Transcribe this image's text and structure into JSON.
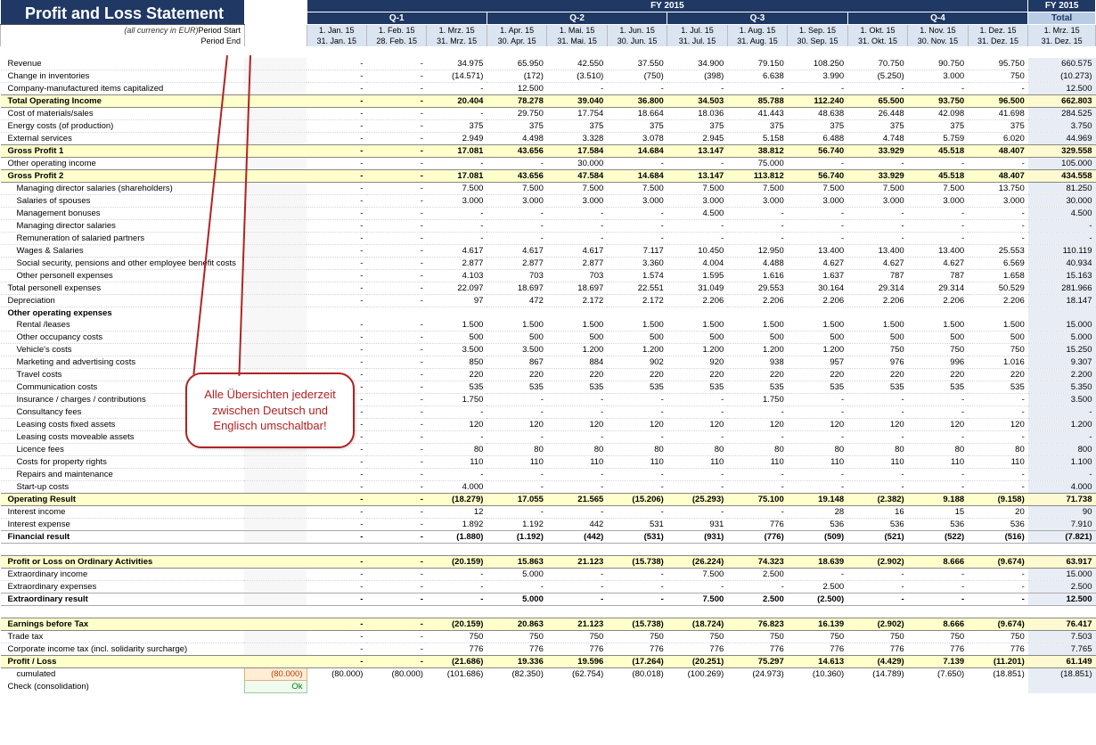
{
  "title": "Profit and Loss Statement",
  "subtitle": "(all currency in EUR)",
  "fy_label": "FY 2015",
  "total_label": "Total",
  "quarters": [
    "Q-1",
    "Q-2",
    "Q-3",
    "Q-4"
  ],
  "period_start_label": "Period Start",
  "period_end_label": "Period End",
  "period_start": [
    "1. Jan. 15",
    "1. Feb. 15",
    "1. Mrz. 15",
    "1. Apr. 15",
    "1. Mai. 15",
    "1. Jun. 15",
    "1. Jul. 15",
    "1. Aug. 15",
    "1. Sep. 15",
    "1. Okt. 15",
    "1. Nov. 15",
    "1. Dez. 15"
  ],
  "period_end": [
    "31. Jan. 15",
    "28. Feb. 15",
    "31. Mrz. 15",
    "30. Apr. 15",
    "31. Mai. 15",
    "30. Jun. 15",
    "31. Jul. 15",
    "31. Aug. 15",
    "30. Sep. 15",
    "31. Okt. 15",
    "30. Nov. 15",
    "31. Dez. 15"
  ],
  "total_period_start": "1. Mrz. 15",
  "total_period_end": "31. Dez. 15",
  "group_value": "(80.000)",
  "ok_value": "Ok",
  "callout_text": "Alle Übersichten jederzeit zwischen Deutsch und Englisch umschaltbar!",
  "rows": [
    {
      "k": "sp"
    },
    {
      "k": "l",
      "cls": "",
      "lbl": "Revenue",
      "v": [
        "-",
        "-",
        "34.975",
        "65.950",
        "42.550",
        "37.550",
        "34.900",
        "79.150",
        "108.250",
        "70.750",
        "90.750",
        "95.750"
      ],
      "t": "660.575"
    },
    {
      "k": "l",
      "cls": "",
      "lbl": "Change in inventories",
      "v": [
        "-",
        "-",
        "(14.571)",
        "(172)",
        "(3.510)",
        "(750)",
        "(398)",
        "6.638",
        "3.990",
        "(5.250)",
        "3.000",
        "750"
      ],
      "t": "(10.273)"
    },
    {
      "k": "l",
      "cls": "",
      "lbl": "Company-manufactured items capitalized",
      "v": [
        "-",
        "-",
        "-",
        "12.500",
        "-",
        "-",
        "-",
        "-",
        "-",
        "-",
        "-",
        "-"
      ],
      "t": "12.500"
    },
    {
      "k": "s",
      "lbl": "Total Operating Income",
      "v": [
        "-",
        "-",
        "20.404",
        "78.278",
        "39.040",
        "36.800",
        "34.503",
        "85.788",
        "112.240",
        "65.500",
        "93.750",
        "96.500"
      ],
      "t": "662.803"
    },
    {
      "k": "l",
      "cls": "",
      "lbl": "Cost of materials/sales",
      "v": [
        "-",
        "-",
        "-",
        "29.750",
        "17.754",
        "18.664",
        "18.036",
        "41.443",
        "48.638",
        "26.448",
        "42.098",
        "41.698"
      ],
      "t": "284.525"
    },
    {
      "k": "l",
      "cls": "",
      "lbl": "Energy costs (of production)",
      "v": [
        "-",
        "-",
        "375",
        "375",
        "375",
        "375",
        "375",
        "375",
        "375",
        "375",
        "375",
        "375"
      ],
      "t": "3.750"
    },
    {
      "k": "l",
      "cls": "",
      "lbl": "External services",
      "v": [
        "-",
        "-",
        "2.949",
        "4.498",
        "3.328",
        "3.078",
        "2.945",
        "5.158",
        "6.488",
        "4.748",
        "5.759",
        "6.020"
      ],
      "t": "44.969"
    },
    {
      "k": "s",
      "lbl": "Gross Profit 1",
      "v": [
        "-",
        "-",
        "17.081",
        "43.656",
        "17.584",
        "14.684",
        "13.147",
        "38.812",
        "56.740",
        "33.929",
        "45.518",
        "48.407"
      ],
      "t": "329.558"
    },
    {
      "k": "l",
      "cls": "",
      "lbl": "Other operating income",
      "v": [
        "-",
        "-",
        "-",
        "-",
        "30.000",
        "-",
        "-",
        "75.000",
        "-",
        "-",
        "-",
        "-"
      ],
      "t": "105.000"
    },
    {
      "k": "s",
      "lbl": "Gross Profit 2",
      "v": [
        "-",
        "-",
        "17.081",
        "43.656",
        "47.584",
        "14.684",
        "13.147",
        "113.812",
        "56.740",
        "33.929",
        "45.518",
        "48.407"
      ],
      "t": "434.558"
    },
    {
      "k": "l",
      "cls": "ind1",
      "lbl": "Managing director salaries (shareholders)",
      "v": [
        "-",
        "-",
        "7.500",
        "7.500",
        "7.500",
        "7.500",
        "7.500",
        "7.500",
        "7.500",
        "7.500",
        "7.500",
        "13.750"
      ],
      "t": "81.250"
    },
    {
      "k": "l",
      "cls": "ind1",
      "lbl": "Salaries of spouses",
      "v": [
        "-",
        "-",
        "3.000",
        "3.000",
        "3.000",
        "3.000",
        "3.000",
        "3.000",
        "3.000",
        "3.000",
        "3.000",
        "3.000"
      ],
      "t": "30.000"
    },
    {
      "k": "l",
      "cls": "ind1",
      "lbl": "Management bonuses",
      "v": [
        "-",
        "-",
        "-",
        "-",
        "-",
        "-",
        "4.500",
        "-",
        "-",
        "-",
        "-",
        "-"
      ],
      "t": "4.500"
    },
    {
      "k": "l",
      "cls": "ind1",
      "lbl": "Managing director salaries",
      "v": [
        "-",
        "-",
        "-",
        "-",
        "-",
        "-",
        "-",
        "-",
        "-",
        "-",
        "-",
        "-"
      ],
      "t": "-"
    },
    {
      "k": "l",
      "cls": "ind1",
      "lbl": "Remuneration of salaried partners",
      "v": [
        "-",
        "-",
        "-",
        "-",
        "-",
        "-",
        "-",
        "-",
        "-",
        "-",
        "-",
        "-"
      ],
      "t": "-"
    },
    {
      "k": "l",
      "cls": "ind1",
      "lbl": "Wages & Salaries",
      "v": [
        "-",
        "-",
        "4.617",
        "4.617",
        "4.617",
        "7.117",
        "10.450",
        "12.950",
        "13.400",
        "13.400",
        "13.400",
        "25.553"
      ],
      "t": "110.119"
    },
    {
      "k": "l",
      "cls": "ind1",
      "lbl": "Social security, pensions and other employee benefit costs",
      "v": [
        "-",
        "-",
        "2.877",
        "2.877",
        "2.877",
        "3.360",
        "4.004",
        "4.488",
        "4.627",
        "4.627",
        "4.627",
        "6.569"
      ],
      "t": "40.934"
    },
    {
      "k": "l",
      "cls": "ind1",
      "lbl": "Other personell expenses",
      "v": [
        "-",
        "-",
        "4.103",
        "703",
        "703",
        "1.574",
        "1.595",
        "1.616",
        "1.637",
        "787",
        "787",
        "1.658"
      ],
      "t": "15.163"
    },
    {
      "k": "l",
      "cls": "",
      "lbl": "Total personell expenses",
      "v": [
        "-",
        "-",
        "22.097",
        "18.697",
        "18.697",
        "22.551",
        "31.049",
        "29.553",
        "30.164",
        "29.314",
        "29.314",
        "50.529"
      ],
      "t": "281.966"
    },
    {
      "k": "l",
      "cls": "",
      "lbl": "Depreciation",
      "v": [
        "-",
        "-",
        "97",
        "472",
        "2.172",
        "2.172",
        "2.206",
        "2.206",
        "2.206",
        "2.206",
        "2.206",
        "2.206"
      ],
      "t": "18.147"
    },
    {
      "k": "h",
      "lbl": "Other operating expenses"
    },
    {
      "k": "l",
      "cls": "ind1",
      "lbl": "Rental /leases",
      "v": [
        "-",
        "-",
        "1.500",
        "1.500",
        "1.500",
        "1.500",
        "1.500",
        "1.500",
        "1.500",
        "1.500",
        "1.500",
        "1.500"
      ],
      "t": "15.000"
    },
    {
      "k": "l",
      "cls": "ind1",
      "lbl": "Other occupancy costs",
      "v": [
        "-",
        "-",
        "500",
        "500",
        "500",
        "500",
        "500",
        "500",
        "500",
        "500",
        "500",
        "500"
      ],
      "t": "5.000"
    },
    {
      "k": "l",
      "cls": "ind1",
      "lbl": "Vehicle's costs",
      "v": [
        "-",
        "-",
        "3.500",
        "3.500",
        "1.200",
        "1.200",
        "1.200",
        "1.200",
        "1.200",
        "750",
        "750",
        "750"
      ],
      "t": "15.250"
    },
    {
      "k": "l",
      "cls": "ind1",
      "lbl": "Marketing and advertising costs",
      "v": [
        "-",
        "-",
        "850",
        "867",
        "884",
        "902",
        "920",
        "938",
        "957",
        "976",
        "996",
        "1.016"
      ],
      "t": "9.307"
    },
    {
      "k": "l",
      "cls": "ind1",
      "lbl": "Travel costs",
      "v": [
        "-",
        "-",
        "220",
        "220",
        "220",
        "220",
        "220",
        "220",
        "220",
        "220",
        "220",
        "220"
      ],
      "t": "2.200"
    },
    {
      "k": "l",
      "cls": "ind1",
      "lbl": "Communication costs",
      "v": [
        "-",
        "-",
        "535",
        "535",
        "535",
        "535",
        "535",
        "535",
        "535",
        "535",
        "535",
        "535"
      ],
      "t": "5.350"
    },
    {
      "k": "l",
      "cls": "ind1",
      "lbl": "Insurance / charges / contributions",
      "v": [
        "-",
        "-",
        "1.750",
        "-",
        "-",
        "-",
        "-",
        "1.750",
        "-",
        "-",
        "-",
        "-"
      ],
      "t": "3.500"
    },
    {
      "k": "l",
      "cls": "ind1",
      "lbl": "Consultancy fees",
      "v": [
        "-",
        "-",
        "-",
        "-",
        "-",
        "-",
        "-",
        "-",
        "-",
        "-",
        "-",
        "-"
      ],
      "t": "-"
    },
    {
      "k": "l",
      "cls": "ind1",
      "lbl": "Leasing costs fixed assets",
      "v": [
        "-",
        "-",
        "120",
        "120",
        "120",
        "120",
        "120",
        "120",
        "120",
        "120",
        "120",
        "120"
      ],
      "t": "1.200"
    },
    {
      "k": "l",
      "cls": "ind1",
      "lbl": "Leasing costs moveable assets",
      "v": [
        "-",
        "-",
        "-",
        "-",
        "-",
        "-",
        "-",
        "-",
        "-",
        "-",
        "-",
        "-"
      ],
      "t": "-"
    },
    {
      "k": "l",
      "cls": "ind1",
      "lbl": "Licence fees",
      "v": [
        "-",
        "-",
        "80",
        "80",
        "80",
        "80",
        "80",
        "80",
        "80",
        "80",
        "80",
        "80"
      ],
      "t": "800"
    },
    {
      "k": "l",
      "cls": "ind1",
      "lbl": "Costs for property rights",
      "v": [
        "-",
        "-",
        "110",
        "110",
        "110",
        "110",
        "110",
        "110",
        "110",
        "110",
        "110",
        "110"
      ],
      "t": "1.100"
    },
    {
      "k": "l",
      "cls": "ind1",
      "lbl": "Repairs and maintenance",
      "v": [
        "-",
        "-",
        "-",
        "-",
        "-",
        "-",
        "-",
        "-",
        "-",
        "-",
        "-",
        "-"
      ],
      "t": "-"
    },
    {
      "k": "l",
      "cls": "ind1",
      "lbl": "Start-up costs",
      "v": [
        "-",
        "-",
        "4.000",
        "-",
        "-",
        "-",
        "-",
        "-",
        "-",
        "-",
        "-",
        "-"
      ],
      "t": "4.000"
    },
    {
      "k": "s",
      "lbl": "Operating Result",
      "v": [
        "-",
        "-",
        "(18.279)",
        "17.055",
        "21.565",
        "(15.206)",
        "(25.293)",
        "75.100",
        "19.148",
        "(2.382)",
        "9.188",
        "(9.158)"
      ],
      "t": "71.738"
    },
    {
      "k": "l",
      "cls": "",
      "lbl": "Interest income",
      "v": [
        "-",
        "-",
        "12",
        "-",
        "-",
        "-",
        "-",
        "-",
        "28",
        "16",
        "15",
        "20"
      ],
      "t": "90"
    },
    {
      "k": "l",
      "cls": "",
      "lbl": "Interest expense",
      "v": [
        "-",
        "-",
        "1.892",
        "1.192",
        "442",
        "531",
        "931",
        "776",
        "536",
        "536",
        "536",
        "536"
      ],
      "t": "7.910"
    },
    {
      "k": "b",
      "lbl": "Financial result",
      "v": [
        "-",
        "-",
        "(1.880)",
        "(1.192)",
        "(442)",
        "(531)",
        "(931)",
        "(776)",
        "(509)",
        "(521)",
        "(522)",
        "(516)"
      ],
      "t": "(7.821)"
    },
    {
      "k": "sp"
    },
    {
      "k": "s",
      "lbl": "Profit or Loss on Ordinary Activities",
      "v": [
        "-",
        "-",
        "(20.159)",
        "15.863",
        "21.123",
        "(15.738)",
        "(26.224)",
        "74.323",
        "18.639",
        "(2.902)",
        "8.666",
        "(9.674)"
      ],
      "t": "63.917"
    },
    {
      "k": "l",
      "cls": "",
      "lbl": "Extraordinary income",
      "v": [
        "-",
        "-",
        "-",
        "5.000",
        "-",
        "-",
        "7.500",
        "2.500",
        "-",
        "-",
        "-",
        "-"
      ],
      "t": "15.000"
    },
    {
      "k": "l",
      "cls": "",
      "lbl": "Extraordinary expenses",
      "v": [
        "-",
        "-",
        "-",
        "-",
        "-",
        "-",
        "-",
        "-",
        "2.500",
        "-",
        "-",
        "-"
      ],
      "t": "2.500"
    },
    {
      "k": "b",
      "lbl": "Extraordinary result",
      "v": [
        "-",
        "-",
        "-",
        "5.000",
        "-",
        "-",
        "7.500",
        "2.500",
        "(2.500)",
        "-",
        "-",
        "-"
      ],
      "t": "12.500"
    },
    {
      "k": "sp"
    },
    {
      "k": "s",
      "lbl": "Earnings before Tax",
      "v": [
        "-",
        "-",
        "(20.159)",
        "20.863",
        "21.123",
        "(15.738)",
        "(18.724)",
        "76.823",
        "16.139",
        "(2.902)",
        "8.666",
        "(9.674)"
      ],
      "t": "76.417"
    },
    {
      "k": "l",
      "cls": "",
      "lbl": "Trade tax",
      "v": [
        "-",
        "-",
        "750",
        "750",
        "750",
        "750",
        "750",
        "750",
        "750",
        "750",
        "750",
        "750"
      ],
      "t": "7.503"
    },
    {
      "k": "l",
      "cls": "",
      "lbl": "Corporate income tax (incl. solidarity surcharge)",
      "v": [
        "-",
        "-",
        "776",
        "776",
        "776",
        "776",
        "776",
        "776",
        "776",
        "776",
        "776",
        "776"
      ],
      "t": "7.765"
    },
    {
      "k": "s",
      "lbl": "Profit / Loss",
      "v": [
        "-",
        "-",
        "(21.686)",
        "19.336",
        "19.596",
        "(17.264)",
        "(20.251)",
        "75.297",
        "14.613",
        "(4.429)",
        "7.139",
        "(11.201)"
      ],
      "t": "61.149"
    },
    {
      "k": "c",
      "lbl": "cumulated",
      "v": [
        "(80.000)",
        "(80.000)",
        "(101.686)",
        "(82.350)",
        "(62.754)",
        "(80.018)",
        "(100.269)",
        "(24.973)",
        "(10.360)",
        "(14.789)",
        "(7.650)",
        "(18.851)"
      ],
      "t": "(18.851)"
    },
    {
      "k": "ok",
      "lbl": "Check (consolidation)"
    }
  ]
}
